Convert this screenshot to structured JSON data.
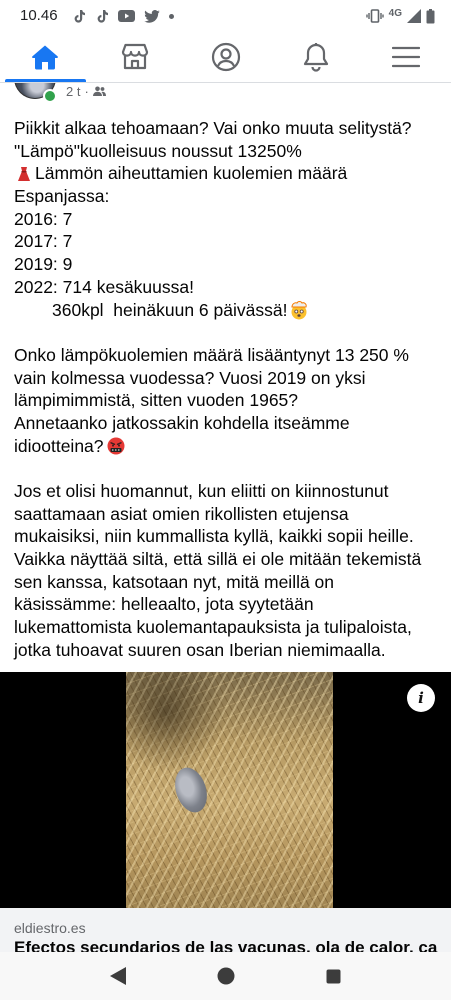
{
  "status_bar": {
    "time": "10.46",
    "network_label": "4G",
    "notification_icons": [
      "tiktok-icon",
      "tiktok-icon",
      "youtube-icon",
      "twitter-icon",
      "more-dot-icon"
    ],
    "system_icons": [
      "vibrate-icon",
      "signal-icon",
      "battery-icon"
    ]
  },
  "top_nav": {
    "accent_color": "#1877f2",
    "icon_color": "#65676b",
    "tabs": [
      {
        "icon": "home-icon",
        "active": true
      },
      {
        "icon": "marketplace-icon",
        "active": false
      },
      {
        "icon": "profile-icon",
        "active": false
      },
      {
        "icon": "bell-icon",
        "active": false
      },
      {
        "icon": "menu-icon",
        "active": false
      }
    ]
  },
  "post": {
    "author_online": true,
    "timestamp": "2 t",
    "separator": "·",
    "audience_icon": "friends-icon",
    "paragraphs": [
      {
        "lines": [
          {
            "text": "Piikkit alkaa tehoamaan? Vai onko muuta selitystä?"
          },
          {
            "text": "\"Lämpö\"kuolleisuus noussut 13250%"
          },
          {
            "text": "Lämmön aiheuttamien kuolemien määrä",
            "icon_before": "red-emoji-icon"
          },
          {
            "text": "Espanjassa:"
          },
          {
            "text": "2016: 7"
          },
          {
            "text": "2017: 7"
          },
          {
            "text": "2019: 9"
          },
          {
            "text": "2022: 714 kesäkuussa!"
          },
          {
            "text": "360kpl  heinäkuun 6 päivässä!",
            "icon_after": "exploding-head-emoji-icon"
          }
        ]
      },
      {
        "lines": [
          {
            "text": "Onko lämpökuolemien määrä lisääntynyt 13 250 %"
          },
          {
            "text": "vain kolmessa vuodessa? Vuosi 2019 on yksi"
          },
          {
            "text": "lämpimimmistä, sitten vuoden 1965?"
          },
          {
            "text": "Annetaanko jatkossakin kohdella itseämme"
          },
          {
            "text": "idiootteina?",
            "icon_after": "angry-face-emoji-icon"
          }
        ]
      },
      {
        "lines": [
          {
            "text": "Jos et olisi huomannut, kun eliitti on kiinnostunut"
          },
          {
            "text": "saattamaan asiat omien rikollisten etujensa"
          },
          {
            "text": "mukaisiksi, niin kummallista kyllä, kaikki sopii heille."
          },
          {
            "text": "Vaikka näyttää siltä, että sillä ei ole mitään tekemistä"
          },
          {
            "text": "sen kanssa, katsotaan nyt, mitä meillä on"
          },
          {
            "text": "käsissämme: helleaalto, jota syytetään"
          },
          {
            "text": "lukemattomista kuolemantapauksista ja tulipaloista,"
          },
          {
            "text": "jotka tuhoavat suuren osan Iberian niemimaalla."
          }
        ]
      }
    ]
  },
  "video": {
    "info_icon": "info-icon"
  },
  "link_preview": {
    "domain": "eldiestro.es",
    "title": "Efectos secundarios de las vacunas, ola de calor, cambio"
  },
  "android_nav": {
    "buttons": [
      "back-icon",
      "home-circle-icon",
      "recents-icon"
    ]
  }
}
